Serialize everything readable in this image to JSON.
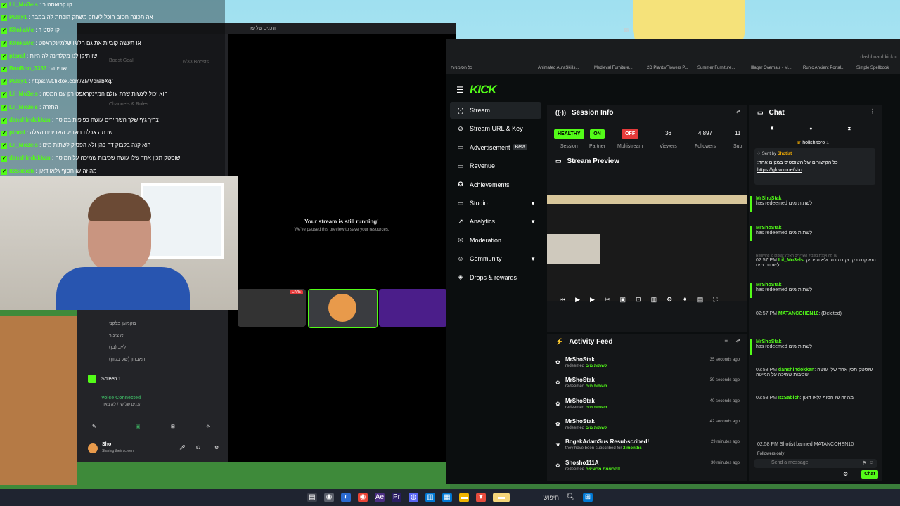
{
  "overlay_chat": [
    {
      "user": "Lil_Mo3els",
      "text": ": קו קרואסט ר"
    },
    {
      "user": "Palay1",
      "text": ": אה תכונה חסוב הוכל לשחק משחק הוכחת לה במבר"
    },
    {
      "user": "K0nkaMc",
      "text": ": קו לסט ר"
    },
    {
      "user": "K0nkaMc",
      "text": ": או תעשה קוביות את גם חלוגו שלמיינקראפט"
    },
    {
      "user": "ptoraf",
      "text": ": שו תיקן לנו מקלדינה לה היות"
    },
    {
      "user": "BooBoo_3333",
      "text": ": שו יבה"
    },
    {
      "user": "Palay1",
      "text": ": https://vt.tiktok.com/ZMVdrabXq/"
    },
    {
      "user": "Lil_Mo3els",
      "text": ": הוא יכול לעשות שרת עולם המיינקראפט רק עם המסה"
    },
    {
      "user": "Lil_Mo3els",
      "text": ": החזרה"
    },
    {
      "user": "danshindokkan",
      "text": ": צריך גיף שלך השריירים עושה כפיפות במיטה"
    },
    {
      "user": "ptoraf",
      "text": ": שו מה אכלת בשביל השרירים האלה"
    },
    {
      "user": "Lil_Mo3els",
      "text": ": הוא קנה בקבוק דה כהן ולא הפסיק לשתות מים"
    },
    {
      "user": "danshindokkan",
      "text": ": שוסטק תכין אחד שלו עושה שכיבות שמיכה על המיטה"
    },
    {
      "user": "ItzSabich",
      "text": ": מה זה שו חסוף גלאו דאון"
    }
  ],
  "discord": {
    "window_title": "הכנים של שו",
    "boost_goal": "Boost Goal",
    "boosts": "6/33 Boosts",
    "channels_roles": "Channels & Roles",
    "stream_running_title": "Your stream is still running!",
    "stream_running_sub": "We've paused this preview to save your resources.",
    "live_badge": "LIVE",
    "voice_users": [
      "מקמוגן בלקני",
      "יא צינור",
      "לייב (בן)",
      "האבדון (של בקוון)"
    ],
    "screen_label": "Screen 1",
    "voice_connected": "Voice Connected",
    "voice_channel": "הכנים של שו / לא באוד",
    "user_name": "Sho",
    "user_status": "Sharing their screen"
  },
  "browser": {
    "url": "dashboard.kick.c",
    "bookmarks": [
      "כל הסימניות",
      "Animated AuraSkills...",
      "Medieval Furniture...",
      "2D Plants/Flowers P...",
      "Summer Furniture...",
      "Illager Overhaul - M...",
      "Runic Ancient Portal...",
      "Simple Spellbook"
    ]
  },
  "kick": {
    "logo": "KICK",
    "nav": [
      {
        "label": "Stream",
        "icon": "(·)",
        "active": true
      },
      {
        "label": "Stream URL & Key",
        "icon": "⊘"
      },
      {
        "label": "Advertisement",
        "icon": "▭",
        "badge": "Beta"
      },
      {
        "label": "Revenue",
        "icon": "▭"
      },
      {
        "label": "Achievements",
        "icon": "✪"
      },
      {
        "label": "Studio",
        "icon": "▭",
        "chevron": true
      },
      {
        "label": "Analytics",
        "icon": "↗",
        "chevron": true
      },
      {
        "label": "Moderation",
        "icon": "◎"
      },
      {
        "label": "Community",
        "icon": "☺",
        "chevron": true
      },
      {
        "label": "Drops & rewards",
        "icon": "◈"
      }
    ],
    "session_info": {
      "title": "Session Info",
      "stats": [
        {
          "value": "HEALTHY",
          "label": "Session",
          "pill": "#53fc18",
          "color": "#000"
        },
        {
          "value": "ON",
          "label": "Partner",
          "pill": "#53fc18",
          "color": "#000"
        },
        {
          "value": "OFF",
          "label": "Multistream",
          "pill": "#e63b3b",
          "color": "#fff"
        },
        {
          "value": "36",
          "label": "Viewers"
        },
        {
          "value": "4,897",
          "label": "Followers"
        },
        {
          "value": "11",
          "label": "Sub"
        }
      ]
    },
    "stream_preview": {
      "title": "Stream Preview"
    },
    "activity_feed": {
      "title": "Activity Feed",
      "items": [
        {
          "name": "MrShoStak",
          "desc": "redeemed",
          "reward": "לשתות מים",
          "time": "35 seconds ago",
          "icon": "✿"
        },
        {
          "name": "MrShoStak",
          "desc": "redeemed",
          "reward": "לשתות מים",
          "time": "39 seconds ago",
          "icon": "✿"
        },
        {
          "name": "MrShoStak",
          "desc": "redeemed",
          "reward": "לשתות מים",
          "time": "40 seconds ago",
          "icon": "✿"
        },
        {
          "name": "MrShoStak",
          "desc": "redeemed",
          "reward": "לשתות מים",
          "time": "42 seconds ago",
          "icon": "✿"
        },
        {
          "name": "BogekAdamSus Resubscribed!",
          "desc": "they have been subscribed for",
          "reward": "2 months",
          "time": "29 minutes ago",
          "icon": "★"
        },
        {
          "name": "Shosho111A",
          "desc": "redeemed",
          "reward": "הרשמת מרשימה!!",
          "time": "30 minutes ago",
          "icon": "✿"
        }
      ]
    },
    "chat": {
      "title": "Chat",
      "pinned_user": "holishitbro",
      "pinned_badge": "1",
      "sent_by_label": "Sent by",
      "sent_by_user": "Shotist",
      "pinned_text": "כל הקישורים של השוסטיס במקום אחד:",
      "pinned_link": "https://glow.moe/sho",
      "messages": [
        {
          "user": "MrShoStak",
          "text": "has redeemed לשתות מים"
        },
        {
          "user": "MrShoStak",
          "text": "has redeemed לשתות מים"
        },
        {
          "time": "02:57 PM",
          "user": "Lil_Mo3els",
          "text": "הוא קנה בקבוק דה כהן ולא הפסיק לשתות מים",
          "reply": "Replying to ptoraf: שו מה אכלת בשביל השרירים האלה"
        },
        {
          "user": "MrShoStak",
          "text": "has redeemed לשתות מים"
        },
        {
          "time": "02:57 PM",
          "user": "MATANCOHEN10",
          "text": "(Deleted)"
        },
        {
          "user": "MrShoStak",
          "text": "has redeemed לשתות מים"
        },
        {
          "time": "02:58 PM",
          "user": "danshindokkan",
          "text": "שוסטק תכין אחד שלו עושה שכיבות שמיכה על המיטה"
        },
        {
          "time": "02:58 PM",
          "user": "ItzSabich",
          "text": "מה זה שו חסוף גלאו דאון"
        }
      ],
      "ban_notice_time": "02:58 PM",
      "ban_notice": "Shotist banned MATANCOHEN10",
      "followers_only": "Followers only",
      "input_placeholder": "Send a message",
      "send_label": "Chat"
    }
  },
  "taskbar": {
    "search": "חיפוש"
  }
}
